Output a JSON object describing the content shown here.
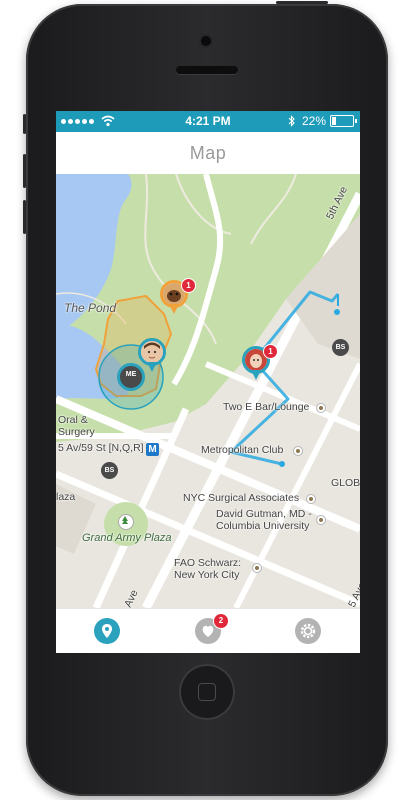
{
  "status_bar": {
    "time": "4:21 PM",
    "battery": "22%",
    "battery_level": 0.22,
    "signal_dots": 5,
    "icons": [
      "wifi-icon",
      "bluetooth-icon",
      "battery-icon"
    ]
  },
  "nav": {
    "title": "Map"
  },
  "map": {
    "labels": {
      "the_pond": "The Pond",
      "fifth_ave": "5th Ave",
      "oral_surgery_1": "Oral &",
      "oral_surgery_2": "Surgery",
      "subway_stop": "5 Av/59 St [N,Q,R]",
      "subway_icon": "M",
      "two_e_bar": "Two E Bar/Lounge",
      "metropolitan_club": "Metropolitan Club",
      "nyc_surgical": "NYC Surgical Associates",
      "gutman_1": "David Gutman, MD -",
      "gutman_2": "Columbia University",
      "grand_army_plaza": "Grand Army Plaza",
      "fao_1": "FAO Schwarz:",
      "fao_2": "New York City",
      "globe": "GLOB",
      "plaza": "laza",
      "ave_bottom_left": "Ave",
      "ave_bottom_right": "5 Ave"
    },
    "badges": {
      "bs": "BS",
      "me": "ME"
    },
    "markers": {
      "dog_count": "1",
      "girl_count": "1"
    },
    "colors": {
      "park": "#c5dfa9",
      "water": "#a3c6f3",
      "road": "#ffffff",
      "zone": "#f0a13a",
      "route": "#2aa9e0",
      "me_ring": "#2aa1bd",
      "badge": "#e0283a"
    }
  },
  "tabs": {
    "map_icon": "map-pin-icon",
    "heart_icon": "heart-icon",
    "heart_badge": "2",
    "settings_icon": "gear-icon",
    "active_color": "#2aa1bd",
    "inactive_color": "#b3b3b3"
  }
}
